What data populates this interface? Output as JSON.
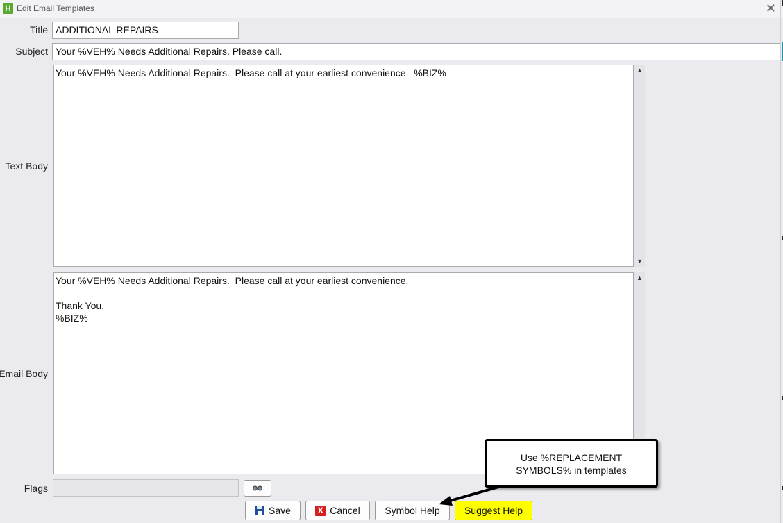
{
  "window": {
    "app_icon_letter": "H",
    "title": "Edit Email Templates",
    "close_glyph": "✕"
  },
  "form": {
    "title_label": "Title",
    "title_value": "ADDITIONAL REPAIRS",
    "subject_label": "Subject",
    "subject_value": "Your %VEH% Needs Additional Repairs.  Please call.",
    "text_body_label": "Text Body",
    "text_body_value": "Your %VEH% Needs Additional Repairs.  Please call at your earliest convenience.  %BIZ%",
    "email_body_label": "Email Body",
    "email_body_value": "Your %VEH% Needs Additional Repairs.  Please call at your earliest convenience.\n\nThank You,\n%BIZ%",
    "flags_label": "Flags",
    "flags_value": ""
  },
  "buttons": {
    "save": "Save",
    "cancel": "Cancel",
    "cancel_icon_glyph": "X",
    "symbol_help": "Symbol Help",
    "suggest_help": "Suggest Help",
    "suggest_help_color": "#ffff00"
  },
  "callout": {
    "line1": "Use %REPLACEMENT",
    "line2": "SYMBOLS% in templates"
  },
  "icons": {
    "app": "app-logo-icon",
    "close": "close-icon",
    "save": "floppy-disk-icon",
    "cancel": "red-x-icon",
    "flags": "eye-glasses-icon",
    "scroll_up": "▲",
    "scroll_down": "▼"
  }
}
